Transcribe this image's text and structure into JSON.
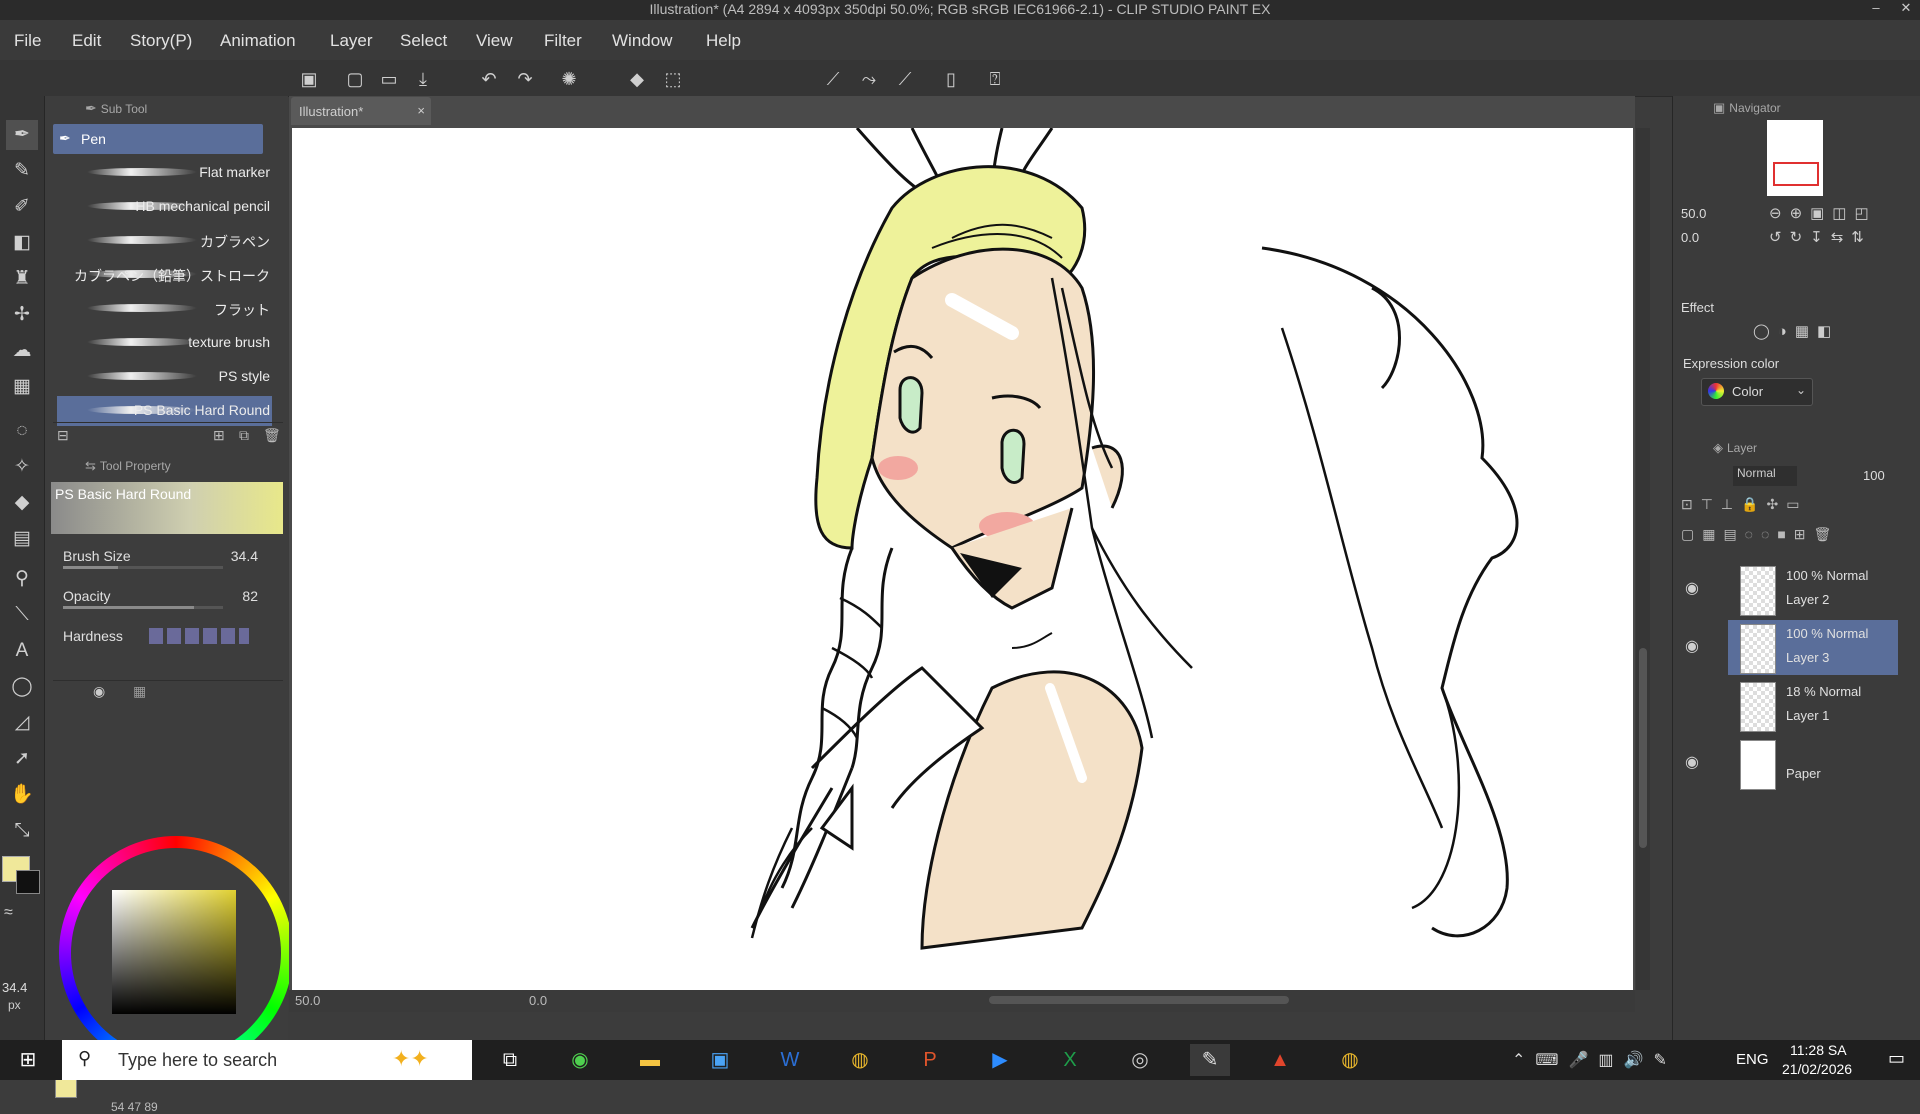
{
  "window": {
    "title": "Illustration* (A4 2894 x 4093px 350dpi 50.0%; RGB sRGB IEC61966-2.1) - CLIP STUDIO PAINT EX"
  },
  "menu": [
    "File",
    "Edit",
    "Story(P)",
    "Animation",
    "Layer",
    "Select",
    "View",
    "Filter",
    "Window",
    "Help"
  ],
  "sub_tool": {
    "title": "Sub Tool",
    "selected": "Pen",
    "brushes": [
      "Flat marker",
      "HB mechanical pencil",
      "カブラペン",
      "カブラペン（鉛筆）ストローク",
      "フラット",
      "texture brush",
      "PS style",
      "PS Basic Hard Round"
    ]
  },
  "tool_property": {
    "title": "Tool Property",
    "brush_name": "PS Basic Hard Round",
    "brush_size_label": "Brush Size",
    "brush_size_value": "34.4",
    "opacity_label": "Opacity",
    "opacity_value": "82",
    "hardness_label": "Hardness"
  },
  "canvas": {
    "tab_label": "Illustration*",
    "zoom": "50.0",
    "angle": "0.0"
  },
  "color": {
    "main_color": "#f0e89a",
    "sub_color": "#111111",
    "size_readout": "34.4",
    "unit": "px",
    "rgb_readout": "54  47  89"
  },
  "navigator": {
    "title": "Navigator",
    "zoom": "50.0",
    "angle": "0.0"
  },
  "layer_property": {
    "effect_label": "Effect",
    "expression_color_label": "Expression color",
    "expression_color_value": "Color"
  },
  "layers_panel": {
    "title": "Layer",
    "blend_mode": "Normal",
    "opacity": "100",
    "layers": [
      {
        "mode": "100 % Normal",
        "name": "Layer 2",
        "selected": false,
        "visible": true
      },
      {
        "mode": "100 % Normal",
        "name": "Layer 3",
        "selected": true,
        "visible": true
      },
      {
        "mode": "18 % Normal",
        "name": "Layer 1",
        "selected": false,
        "visible": false
      },
      {
        "mode": "",
        "name": "Paper",
        "selected": false,
        "visible": true
      }
    ]
  },
  "taskbar": {
    "search_placeholder": "Type here to search",
    "language": "ENG",
    "time": "11:28 SA",
    "date": "21/02/2026"
  },
  "colors": {
    "hair": "#eef29a",
    "skin": "#f4e1c8",
    "blush": "#f2a8a0",
    "eyes": "#c8ecc8",
    "panel_bg": "#3d3d3d",
    "selected_row": "#5a6e9a"
  }
}
